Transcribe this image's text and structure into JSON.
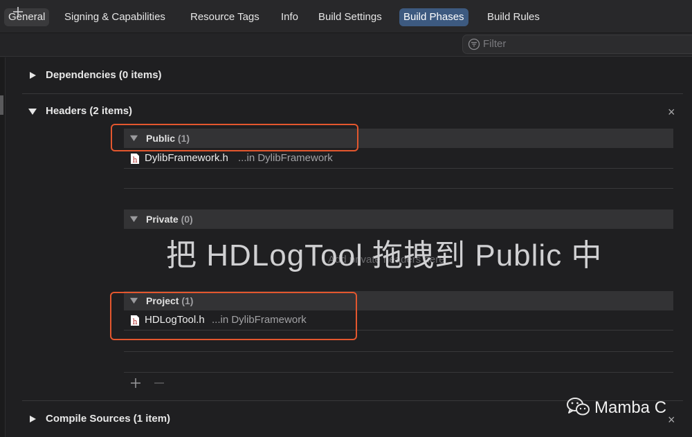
{
  "tabs": [
    {
      "label": "General"
    },
    {
      "label": "Signing & Capabilities"
    },
    {
      "label": "Resource Tags"
    },
    {
      "label": "Info"
    },
    {
      "label": "Build Settings"
    },
    {
      "label": "Build Phases",
      "active": true
    },
    {
      "label": "Build Rules"
    }
  ],
  "toolbar": {
    "add_icon": "plus-icon",
    "filter_placeholder": "Filter",
    "filter_icon": "filter-icon"
  },
  "sections": {
    "dependencies": {
      "title": "Dependencies (0 items)"
    },
    "headers": {
      "title": "Headers (2 items)",
      "public": {
        "label": "Public",
        "count": "(1)",
        "files": [
          {
            "name": "DylibFramework.h",
            "location": "...in DylibFramework"
          }
        ]
      },
      "private": {
        "label": "Private",
        "count": "(0)",
        "placeholder": "Add private headers here"
      },
      "project": {
        "label": "Project",
        "count": "(1)",
        "files": [
          {
            "name": "HDLogTool.h",
            "location": "...in DylibFramework"
          }
        ]
      }
    },
    "compile_sources": {
      "title": "Compile Sources (1 item)"
    }
  },
  "annotation": {
    "caption": "把 HDLogTool 拖拽到 Public 中",
    "highlight_color": "#e4572e"
  },
  "watermark": {
    "text": "Mamba C",
    "icon": "wechat-icon"
  },
  "colors": {
    "active_tab": "#3d5a80",
    "background": "#1f1f21"
  }
}
